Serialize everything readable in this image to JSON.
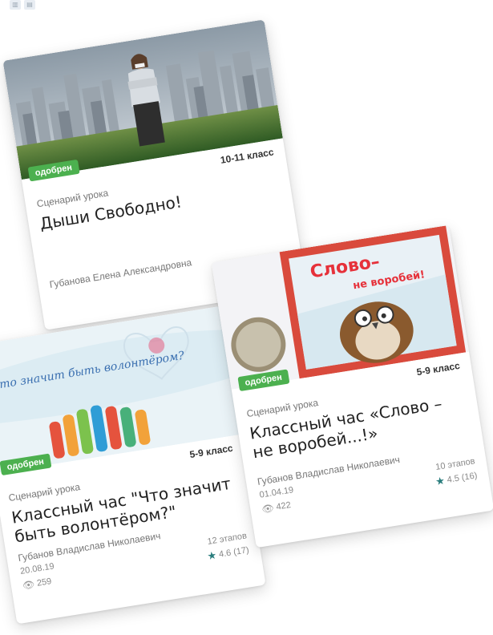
{
  "cards": [
    {
      "badge": "одобрен",
      "grade": "10-11 класс",
      "kind": "Сценарий урока",
      "title": "Дыши Свободно!",
      "author": "Губанова Елена Александровна"
    },
    {
      "badge": "одобрен",
      "grade": "5-9 класс",
      "kind": "Сценарий урока",
      "title": "Классный час \"Что значит быть волонтёром?\"",
      "author": "Губанов Владислав Николаевич",
      "date": "20.08.19",
      "stages": "12 этапов",
      "rating": "4.6 (17)",
      "views": "259",
      "banner_text": "Что значит быть волонтёром?"
    },
    {
      "badge": "одобрен",
      "grade": "5-9 класс",
      "kind": "Сценарий урока",
      "title": "Классный час «Слово – не воробей...!»",
      "author": "Губанов Владислав Николаевич",
      "date": "01.04.19",
      "stages": "10 этапов",
      "rating": "4.5 (16)",
      "views": "422",
      "poster_line1": "Слово–",
      "poster_line2": "не воробей!"
    }
  ],
  "colors": {
    "badge": "#4cb04f",
    "star": "#2a7d7d",
    "title": "#222222",
    "muted": "#777777"
  },
  "icons": {
    "star": "star-icon",
    "views": "eye-icon"
  }
}
